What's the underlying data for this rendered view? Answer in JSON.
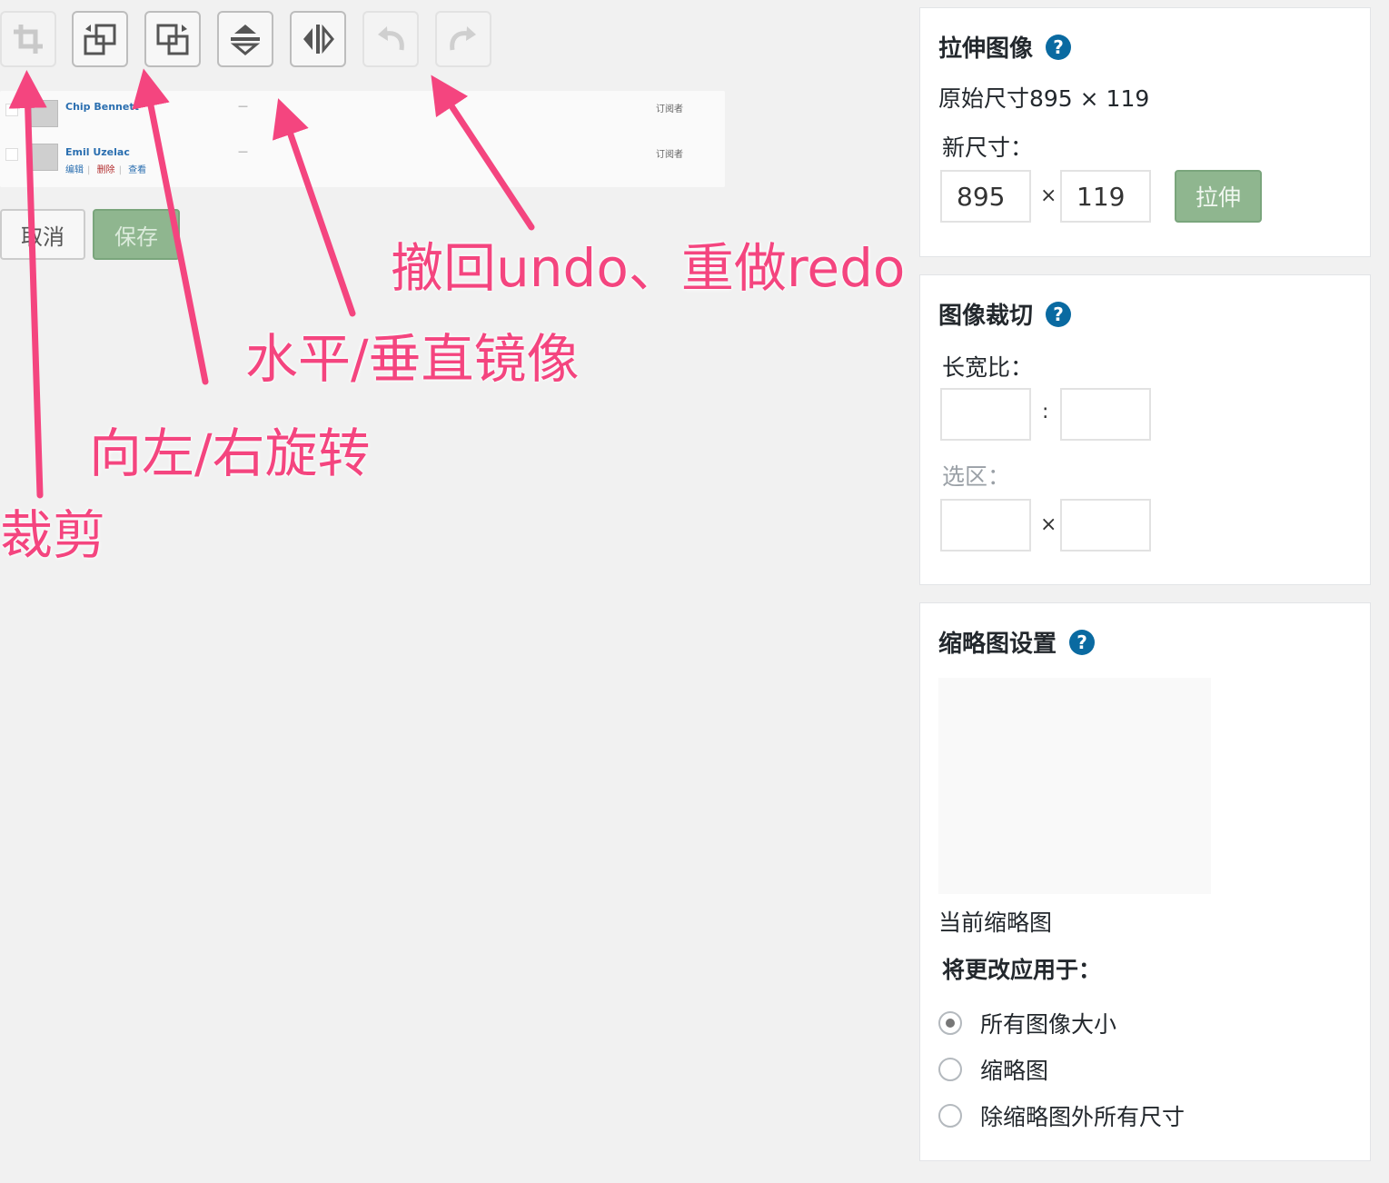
{
  "toolbar": {
    "buttons": [
      {
        "name": "crop",
        "icon": "crop-icon",
        "enabled": false
      },
      {
        "name": "rotate-left",
        "icon": "rotate-left-icon",
        "enabled": true
      },
      {
        "name": "rotate-right",
        "icon": "rotate-right-icon",
        "enabled": true
      },
      {
        "name": "flip-vertical",
        "icon": "flip-vertical-icon",
        "enabled": true
      },
      {
        "name": "flip-horizontal",
        "icon": "flip-horizontal-icon",
        "enabled": true
      },
      {
        "name": "undo",
        "icon": "undo-icon",
        "enabled": false
      },
      {
        "name": "redo",
        "icon": "redo-icon",
        "enabled": false
      }
    ]
  },
  "preview": {
    "rows": [
      {
        "name": "Chip Bennett",
        "dash": "—",
        "role": "订阅者"
      },
      {
        "name": "Emil Uzelac",
        "dash": "—",
        "role": "订阅者",
        "actions": {
          "edit": "编辑",
          "delete": "删除",
          "view": "查看",
          "sep": "|"
        }
      }
    ]
  },
  "actions": {
    "cancel": "取消",
    "save": "保存"
  },
  "annotations": {
    "crop": "裁剪",
    "rotate": "向左/右旋转",
    "mirror": "水平/垂直镜像",
    "undo_redo": "撤回undo、重做redo",
    "color": "#f4457f"
  },
  "scale_panel": {
    "title": "拉伸图像",
    "help": "?",
    "original": "原始尺寸895 × 119",
    "new_size_label": "新尺寸：",
    "width": "895",
    "height": "119",
    "times": "×",
    "button": "拉伸"
  },
  "crop_panel": {
    "title": "图像裁切",
    "help": "?",
    "ratio_label": "长宽比：",
    "ratio_sep": ":",
    "selection_label": "选区：",
    "times": "×"
  },
  "thumb_panel": {
    "title": "缩略图设置",
    "help": "?",
    "current_label": "当前缩略图",
    "apply_label": "将更改应用于：",
    "options": [
      {
        "label": "所有图像大小",
        "checked": true
      },
      {
        "label": "缩略图",
        "checked": false
      },
      {
        "label": "除缩略图外所有尺寸",
        "checked": false
      }
    ]
  },
  "colors": {
    "accent_green": "#8fb68f",
    "help_blue": "#0a6aa1",
    "background": "#f1f1f1"
  }
}
